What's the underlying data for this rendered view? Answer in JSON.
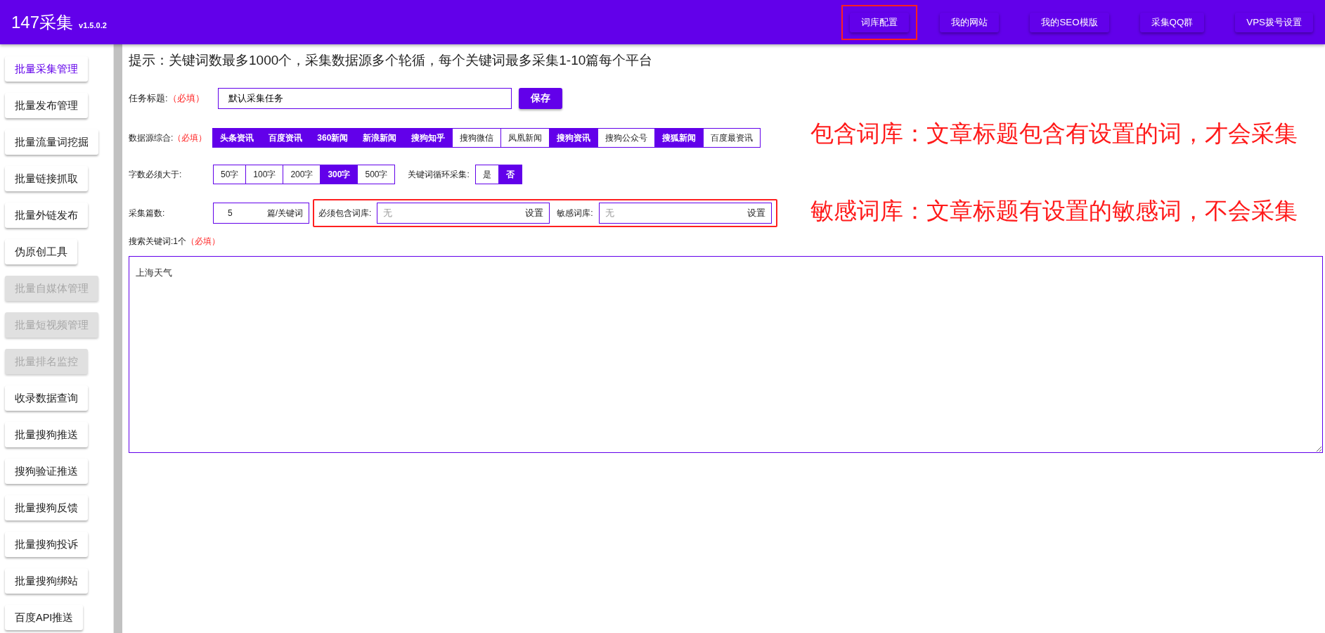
{
  "header": {
    "title": "147采集",
    "version": "v1.5.0.2",
    "nav": [
      {
        "label": "词库配置",
        "highlighted": true
      },
      {
        "label": "我的网站",
        "highlighted": false
      },
      {
        "label": "我的SEO模版",
        "highlighted": false
      },
      {
        "label": "采集QQ群",
        "highlighted": false
      },
      {
        "label": "VPS拨号设置",
        "highlighted": false
      }
    ]
  },
  "sidebar": {
    "items": [
      {
        "label": "批量采集管理",
        "selected": true,
        "disabled": false
      },
      {
        "label": "批量发布管理",
        "selected": false,
        "disabled": false
      },
      {
        "label": "批量流量词挖掘",
        "selected": false,
        "disabled": false
      },
      {
        "label": "批量链接抓取",
        "selected": false,
        "disabled": false
      },
      {
        "label": "批量外链发布",
        "selected": false,
        "disabled": false
      },
      {
        "label": "伪原创工具",
        "selected": false,
        "disabled": false
      },
      {
        "label": "批量自媒体管理",
        "selected": false,
        "disabled": true
      },
      {
        "label": "批量短视频管理",
        "selected": false,
        "disabled": true
      },
      {
        "label": "批量排名监控",
        "selected": false,
        "disabled": true
      },
      {
        "label": "收录数据查询",
        "selected": false,
        "disabled": false
      },
      {
        "label": "批量搜狗推送",
        "selected": false,
        "disabled": false
      },
      {
        "label": "搜狗验证推送",
        "selected": false,
        "disabled": false
      },
      {
        "label": "批量搜狗反馈",
        "selected": false,
        "disabled": false
      },
      {
        "label": "批量搜狗投诉",
        "selected": false,
        "disabled": false
      },
      {
        "label": "批量搜狗绑站",
        "selected": false,
        "disabled": false
      },
      {
        "label": "百度API推送",
        "selected": false,
        "disabled": false
      }
    ]
  },
  "form": {
    "hint": "提示：关键词数最多1000个，采集数据源多个轮循，每个关键词最多采集1-10篇每个平台",
    "task_title": {
      "label": "任务标题:",
      "required": "（必填）",
      "value": "默认采集任务",
      "button": "保存"
    },
    "sources": {
      "label": "数据源综合:",
      "required": "（必填）",
      "options": [
        {
          "label": "头条资讯",
          "selected": true
        },
        {
          "label": "百度资讯",
          "selected": true
        },
        {
          "label": "360新闻",
          "selected": true
        },
        {
          "label": "新浪新闻",
          "selected": true
        },
        {
          "label": "搜狗知乎",
          "selected": true
        },
        {
          "label": "搜狗微信",
          "selected": false
        },
        {
          "label": "凤凰新闻",
          "selected": false
        },
        {
          "label": "搜狗资讯",
          "selected": true
        },
        {
          "label": "搜狗公众号",
          "selected": false
        },
        {
          "label": "搜狐新闻",
          "selected": true
        },
        {
          "label": "百度最资讯",
          "selected": false
        }
      ]
    },
    "min_words": {
      "label": "字数必须大于:",
      "options": [
        {
          "label": "50字",
          "selected": false
        },
        {
          "label": "100字",
          "selected": false
        },
        {
          "label": "200字",
          "selected": false
        },
        {
          "label": "300字",
          "selected": true
        },
        {
          "label": "500字",
          "selected": false
        }
      ]
    },
    "loop": {
      "label": "关键词循环采集:",
      "options": [
        {
          "label": "是",
          "selected": false
        },
        {
          "label": "否",
          "selected": true
        }
      ]
    },
    "count": {
      "label": "采集篇数:",
      "value": "5",
      "unit": "篇/关键词"
    },
    "libraries": {
      "highlighted": true,
      "items": [
        {
          "label": "必须包含词库:",
          "placeholder": "无",
          "button": "设置"
        },
        {
          "label": "敏感词库:",
          "placeholder": "无",
          "button": "设置"
        }
      ]
    },
    "keywords": {
      "label": "搜索关键词:1个",
      "required": "（必填）",
      "value": "上海天气"
    }
  },
  "annotations": [
    "包含词库：文章标题包含有设置的词，才会采集",
    "敏感词库：文章标题有设置的敏感词，不会采集"
  ]
}
